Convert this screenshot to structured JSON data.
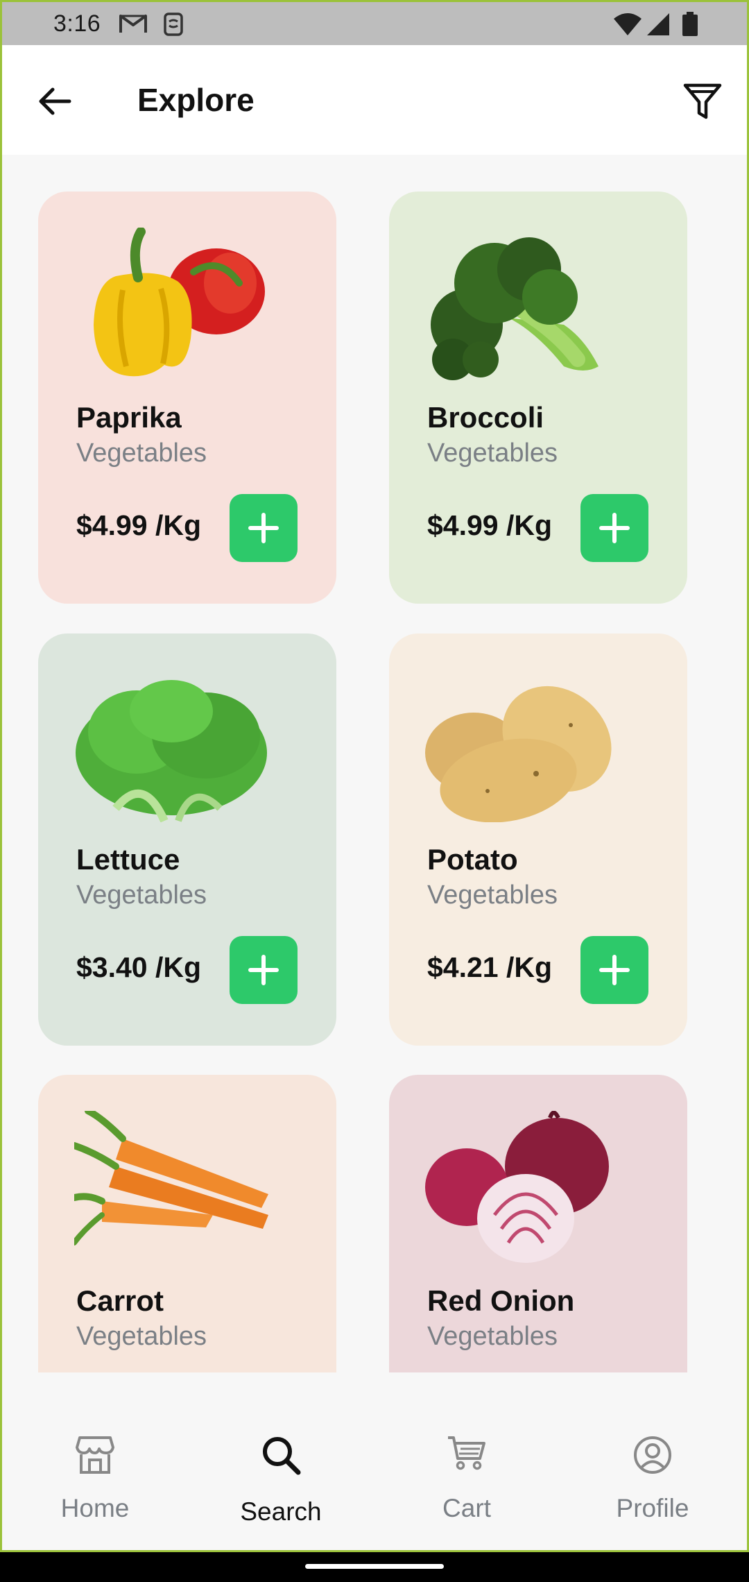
{
  "status_bar": {
    "time": "3:16"
  },
  "header": {
    "title": "Explore"
  },
  "products": [
    {
      "name": "Paprika",
      "category": "Vegetables",
      "price": "$4.99 /Kg",
      "bg": "#f8e1dc"
    },
    {
      "name": "Broccoli",
      "category": "Vegetables",
      "price": "$4.99 /Kg",
      "bg": "#e3edd8"
    },
    {
      "name": "Lettuce",
      "category": "Vegetables",
      "price": "$3.40 /Kg",
      "bg": "#dce6dd"
    },
    {
      "name": "Potato",
      "category": "Vegetables",
      "price": "$4.21 /Kg",
      "bg": "#f7ede1"
    },
    {
      "name": "Carrot",
      "category": "Vegetables",
      "price": "",
      "bg": "#f7e6dc"
    },
    {
      "name": "Red Onion",
      "category": "Vegetables",
      "price": "",
      "bg": "#ecd7da"
    }
  ],
  "nav": {
    "items": [
      {
        "label": "Home",
        "icon": "store-icon"
      },
      {
        "label": "Search",
        "icon": "search-icon",
        "active": true
      },
      {
        "label": "Cart",
        "icon": "cart-icon"
      },
      {
        "label": "Profile",
        "icon": "profile-icon"
      }
    ]
  },
  "colors": {
    "accent": "#2dc96a"
  }
}
